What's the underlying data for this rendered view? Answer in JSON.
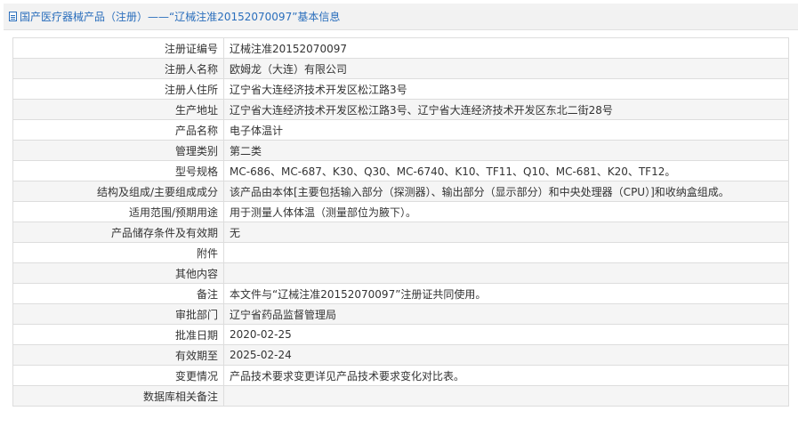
{
  "header": {
    "icon": "document-icon",
    "title": "国产医疗器械产品（注册）——“辽械注准20152070097”基本信息"
  },
  "rows": [
    {
      "label": "注册证编号",
      "value": "辽械注准20152070097"
    },
    {
      "label": "注册人名称",
      "value": "欧姆龙（大连）有限公司"
    },
    {
      "label": "注册人住所",
      "value": "辽宁省大连经济技术开发区松江路3号"
    },
    {
      "label": "生产地址",
      "value": "辽宁省大连经济技术开发区松江路3号、辽宁省大连经济技术开发区东北二街28号"
    },
    {
      "label": "产品名称",
      "value": "电子体温计"
    },
    {
      "label": "管理类别",
      "value": "第二类"
    },
    {
      "label": "型号规格",
      "value": "MC-686、MC-687、K30、Q30、MC-6740、K10、TF11、Q10、MC-681、K20、TF12。"
    },
    {
      "label": "结构及组成/主要组成成分",
      "value": "该产品由本体[主要包括输入部分（探测器）、输出部分（显示部分）和中央处理器（CPU）]和收纳盒组成。"
    },
    {
      "label": "适用范围/预期用途",
      "value": "用于测量人体体温（测量部位为腋下）。"
    },
    {
      "label": "产品储存条件及有效期",
      "value": "无"
    },
    {
      "label": "附件",
      "value": ""
    },
    {
      "label": "其他内容",
      "value": ""
    },
    {
      "label": "备注",
      "value": "本文件与“辽械注准20152070097”注册证共同使用。"
    },
    {
      "label": "审批部门",
      "value": "辽宁省药品监督管理局"
    },
    {
      "label": "批准日期",
      "value": "2020-02-25"
    },
    {
      "label": "有效期至",
      "value": "2025-02-24"
    },
    {
      "label": "变更情况",
      "value": "产品技术要求变更详见产品技术要求变化对比表。"
    },
    {
      "label": "数据库相关备注",
      "value": ""
    }
  ],
  "colors": {
    "accent": "#2a6ebc",
    "border": "#dddddd",
    "stripe": "#f5f5f5",
    "header_bg": "#f2f2f2"
  }
}
